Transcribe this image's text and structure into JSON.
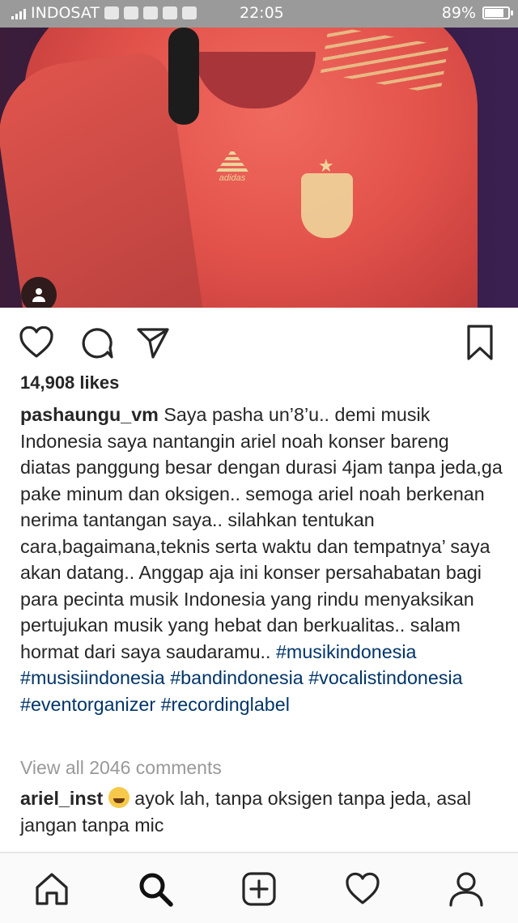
{
  "status_bar": {
    "carrier": "INDOSAT",
    "time": "22:05",
    "battery_text": "89%",
    "battery_level": 0.89
  },
  "post": {
    "likes": "14,908 likes",
    "caption_username": "pashaungu_vm",
    "caption_text": "Saya pasha un’8’u.. demi musik Indonesia saya nantangin ariel noah konser bareng diatas panggung besar dengan durasi 4jam tanpa jeda,ga pake minum dan oksigen.. semoga ariel noah berkenan nerima tantangan saya.. silahkan tentukan cara,bagaimana,teknis serta waktu dan tempatnya’ saya akan datang.. Anggap aja ini konser persahabatan bagi para pecinta musik Indonesia yang rindu menyaksikan pertujukan musik yang hebat dan berkualitas.. salam hormat dari saya saudaramu..",
    "hashtags": [
      "#musikindonesia",
      "#musisiindonesia",
      "#bandindonesia",
      "#vocalistindonesia",
      "#eventorganizer",
      "#recordinglabel"
    ],
    "view_all_comments": "View all 2046 comments",
    "comment": {
      "username": "ariel_inst",
      "text": "ayok lah, tanpa oksigen tanpa jeda, asal jangan tanpa mic"
    },
    "image_logo_text": "adidas"
  },
  "icons": {
    "like": "heart-icon",
    "comment": "comment-icon",
    "share": "send-icon",
    "save": "bookmark-icon",
    "user_tag": "user-tag-icon"
  },
  "bottom_nav": [
    "home-icon",
    "search-icon",
    "add-post-icon",
    "activity-heart-icon",
    "profile-icon"
  ],
  "colors": {
    "hashtag": "#003569",
    "muted": "#999999",
    "text": "#262626",
    "status_bar": "#9a9a9a"
  }
}
